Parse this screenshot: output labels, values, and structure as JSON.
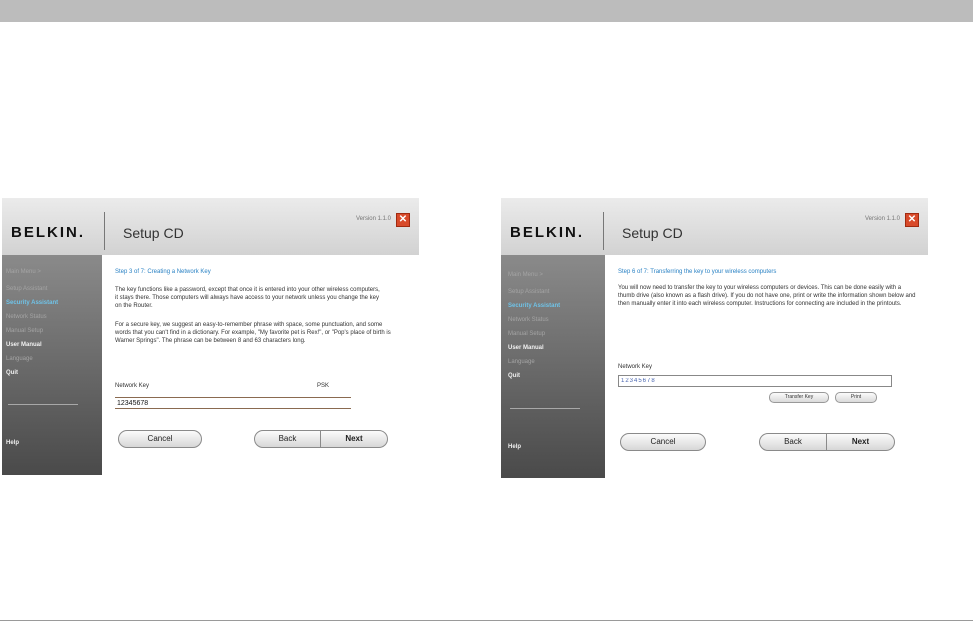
{
  "windows": [
    {
      "brand": "BELKIN.",
      "title": "Setup CD",
      "version": "Version 1.1.0",
      "close_glyph": "✕",
      "sidebar": {
        "items": [
          "Main Menu  >",
          "Setup Assistant",
          "Security Assistant",
          "Network Status",
          "Manual Setup",
          "User Manual",
          "Language",
          "Quit"
        ],
        "active": "Security Assistant",
        "help": "Help"
      },
      "step": "Step 3 of 7: Creating a Network Key",
      "paragraphs": [
        "The key functions like a password, except that once it is entered into your other wireless computers, it stays there. Those computers will always have access to your network unless you change the key on the Router.",
        "For a secure key, we suggest an easy-to-remember phrase with space, some punctuation, and some words that you can't find in a dictionary. For example, \"My favorite pet is Rex!\", or \"Pop's place of birth is Warner Springs\". The phrase can be between 8 and 63 characters long."
      ],
      "network_key_label": "Network Key",
      "psk_label": "PSK",
      "network_key_value": "12345678",
      "buttons": {
        "cancel": "Cancel",
        "back": "Back",
        "next": "Next"
      }
    },
    {
      "brand": "BELKIN.",
      "title": "Setup CD",
      "version": "Version 1.1.0",
      "close_glyph": "✕",
      "sidebar": {
        "items": [
          "Main Menu  >",
          "Setup Assistant",
          "Security Assistant",
          "Network Status",
          "Manual Setup",
          "User Manual",
          "Language",
          "Quit"
        ],
        "active": "Security Assistant",
        "help": "Help"
      },
      "step": "Step 6 of 7: Transferring the key to your wireless computers",
      "paragraphs": [
        "You will now need to transfer the key to your wireless computers or devices. This can be done easily with a thumb drive (also known as a flash drive). If you do not have one, print or write the information shown below and then manually enter it into each wireless computer. Instructions for connecting are included in the printouts."
      ],
      "network_key_label": "Network Key",
      "network_key_value": "12345678",
      "transfer_key": "Transfer Key",
      "print": "Print",
      "buttons": {
        "cancel": "Cancel",
        "back": "Back",
        "next": "Next"
      }
    }
  ],
  "colors": {
    "accent": "#2a82c4",
    "active_sidebar": "#6fc3e8",
    "close": "#d84a2a"
  }
}
